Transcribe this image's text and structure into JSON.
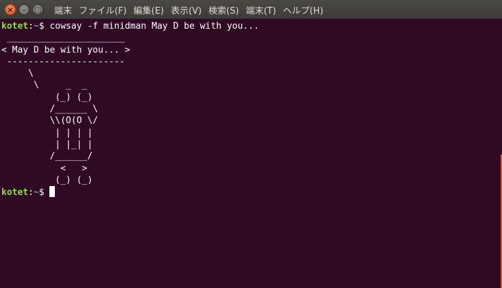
{
  "titlebar": {
    "buttons": {
      "close": "×",
      "minimize": "–",
      "maximize": "□"
    },
    "menu": [
      "端末",
      "ファイル(F)",
      "編集(E)",
      "表示(V)",
      "検索(S)",
      "端末(T)",
      "ヘルプ(H)"
    ]
  },
  "terminal": {
    "user": "kotet",
    "sep": ":",
    "path": "~",
    "dollar": "$",
    "command": " cowsay -f minidman May D be with you...",
    "output": [
      " ______________________",
      "< May D be with you... >",
      " ----------------------",
      "     \\",
      "      \\     _  _",
      "          (_) (_)",
      "         /______ \\",
      "         \\\\(O(O \\/",
      "          | | | |",
      "          | |_| |",
      "         /______/",
      "           <   >",
      "          (_) (_)"
    ]
  },
  "colors": {
    "background": "#300a24",
    "prompt_user": "#8ae234",
    "prompt_path": "#729fcf",
    "scroll_accent": "#e95420"
  }
}
